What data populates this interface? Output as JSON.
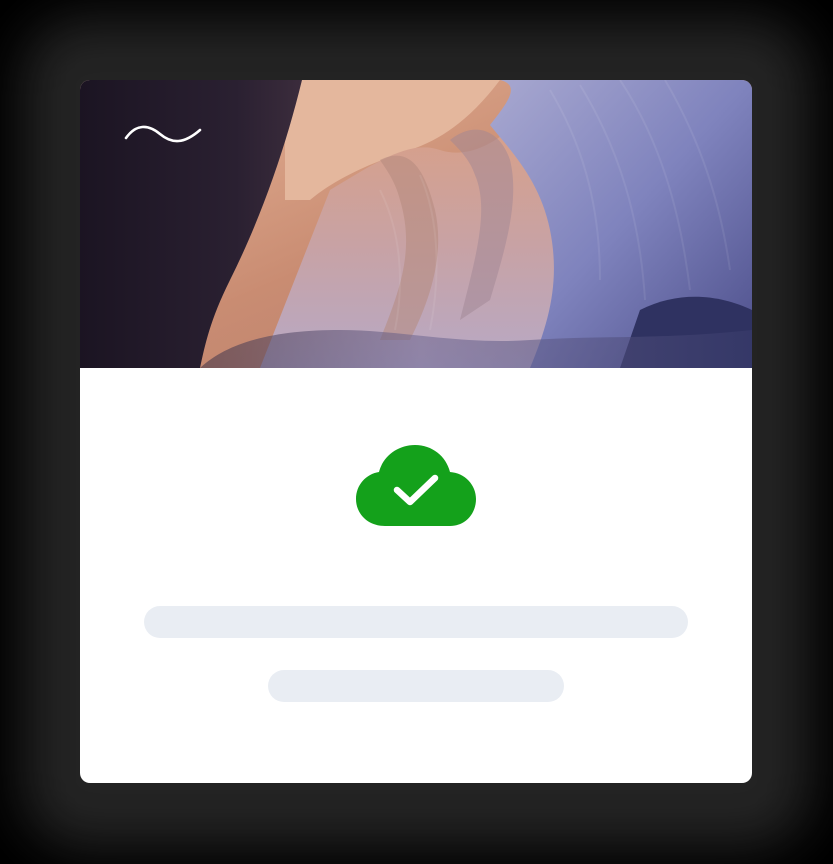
{
  "card": {
    "hero_image": "slot-canyon-photo",
    "logo_icon": "wave-logo-icon",
    "status_icon": "cloud-check-icon",
    "status": "success",
    "placeholder_lines": 2
  },
  "colors": {
    "page_background": "#000000",
    "card_background": "#ffffff",
    "success_green": "#14a11b",
    "skeleton": "#e9edf3",
    "logo_stroke": "#ffffff"
  }
}
